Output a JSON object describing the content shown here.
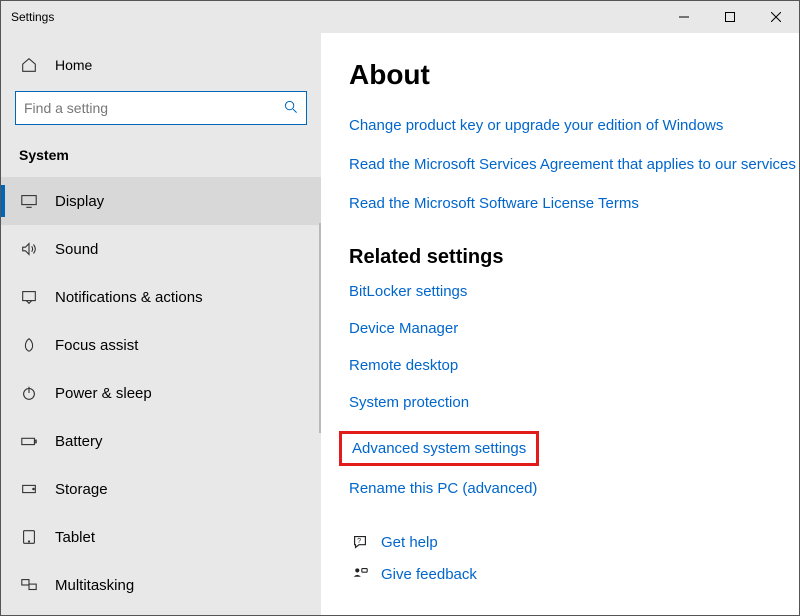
{
  "window": {
    "title": "Settings"
  },
  "sidebar": {
    "home": "Home",
    "search_placeholder": "Find a setting",
    "category": "System",
    "items": [
      {
        "label": "Display"
      },
      {
        "label": "Sound"
      },
      {
        "label": "Notifications & actions"
      },
      {
        "label": "Focus assist"
      },
      {
        "label": "Power & sleep"
      },
      {
        "label": "Battery"
      },
      {
        "label": "Storage"
      },
      {
        "label": "Tablet"
      },
      {
        "label": "Multitasking"
      }
    ]
  },
  "main": {
    "heading": "About",
    "top_links": [
      "Change product key or upgrade your edition of Windows",
      "Read the Microsoft Services Agreement that applies to our services",
      "Read the Microsoft Software License Terms"
    ],
    "related_heading": "Related settings",
    "related_links": [
      "BitLocker settings",
      "Device Manager",
      "Remote desktop",
      "System protection",
      "Advanced system settings",
      "Rename this PC (advanced)"
    ],
    "support": {
      "help": "Get help",
      "feedback": "Give feedback"
    }
  }
}
